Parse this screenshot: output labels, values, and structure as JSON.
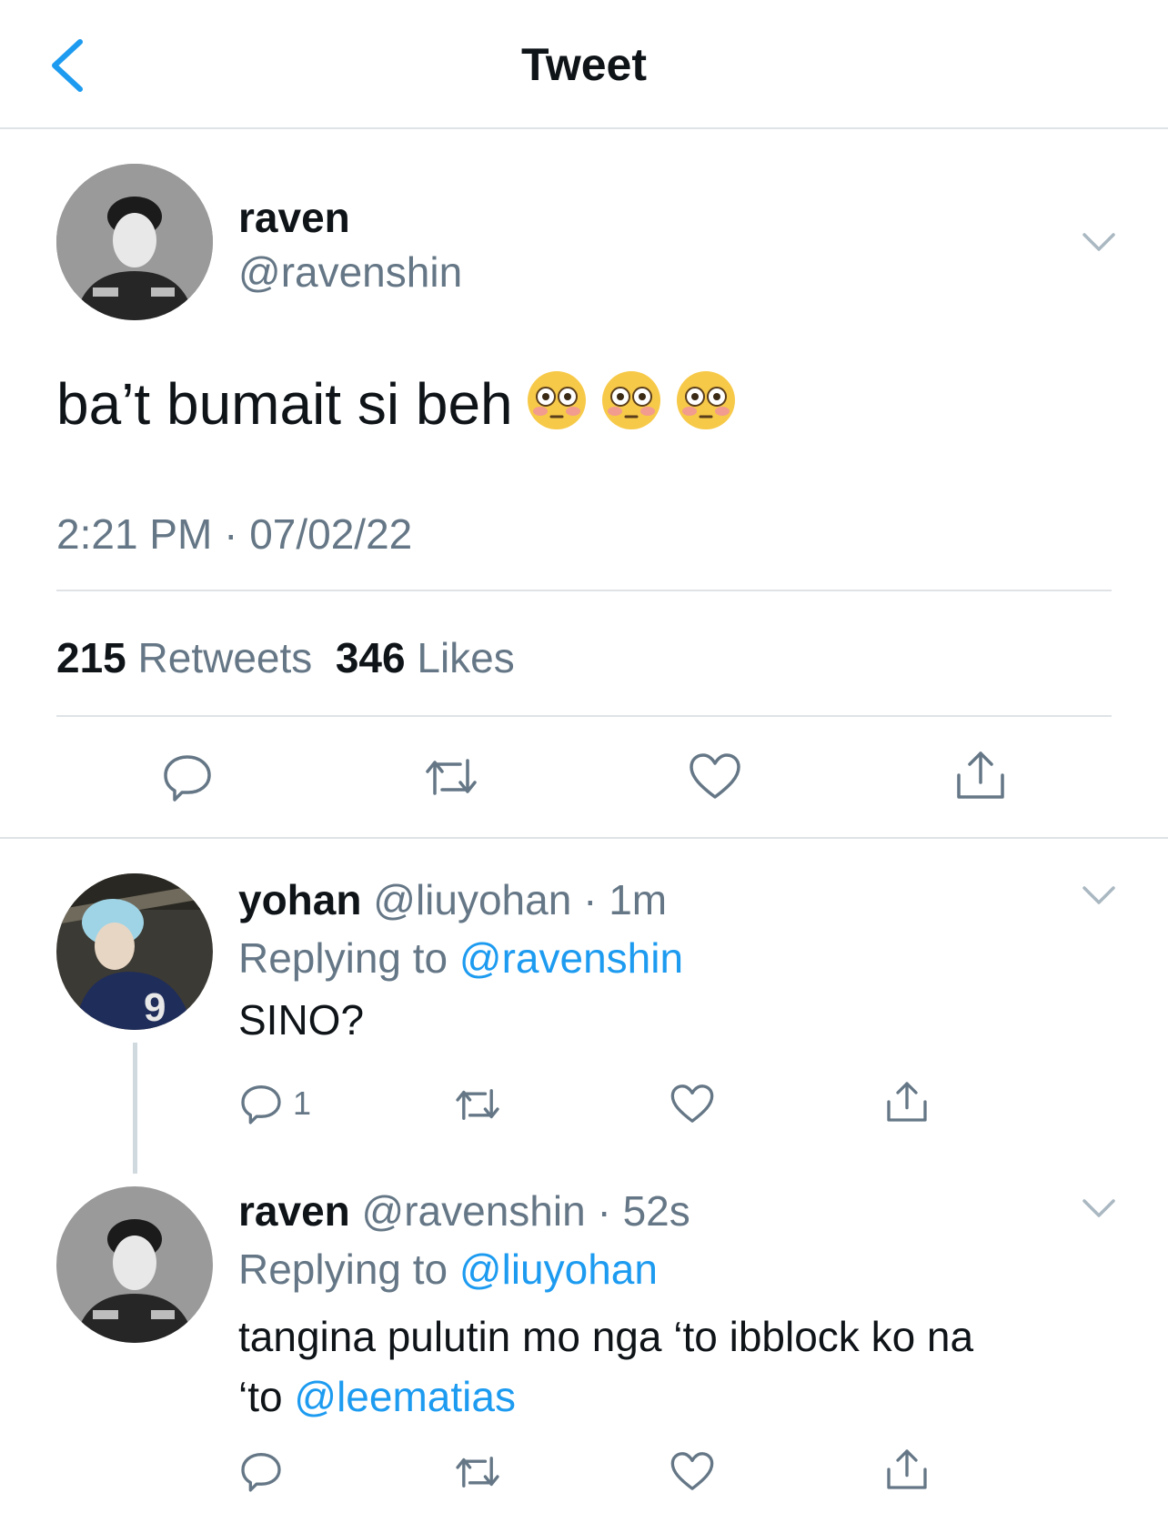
{
  "header": {
    "title": "Tweet"
  },
  "main_tweet": {
    "name": "raven",
    "handle": "@ravenshin",
    "text": "ba’t bumait si beh",
    "emoji_count": 3,
    "timestamp": "2:21 PM · 07/02/22",
    "retweets_count": "215",
    "retweets_label": "Retweets",
    "likes_count": "346",
    "likes_label": "Likes"
  },
  "replies": [
    {
      "name": "yohan",
      "handle": "@liuyohan",
      "time": "· 1m",
      "replying_label": "Replying to",
      "replying_to": "@ravenshin",
      "text": "SINO?",
      "reply_count": "1"
    },
    {
      "name": "raven",
      "handle": "@ravenshin",
      "time": "· 52s",
      "replying_label": "Replying to",
      "replying_to": "@liuyohan",
      "text_line1": "tangina pulutin mo nga ‘to ibblock ko na",
      "text_line2_prefix": "‘to",
      "mention": "@leematias"
    }
  ],
  "colors": {
    "accent": "#1d9bf0",
    "muted": "#657786",
    "text": "#0f1419",
    "divider": "#dfe3e6"
  }
}
